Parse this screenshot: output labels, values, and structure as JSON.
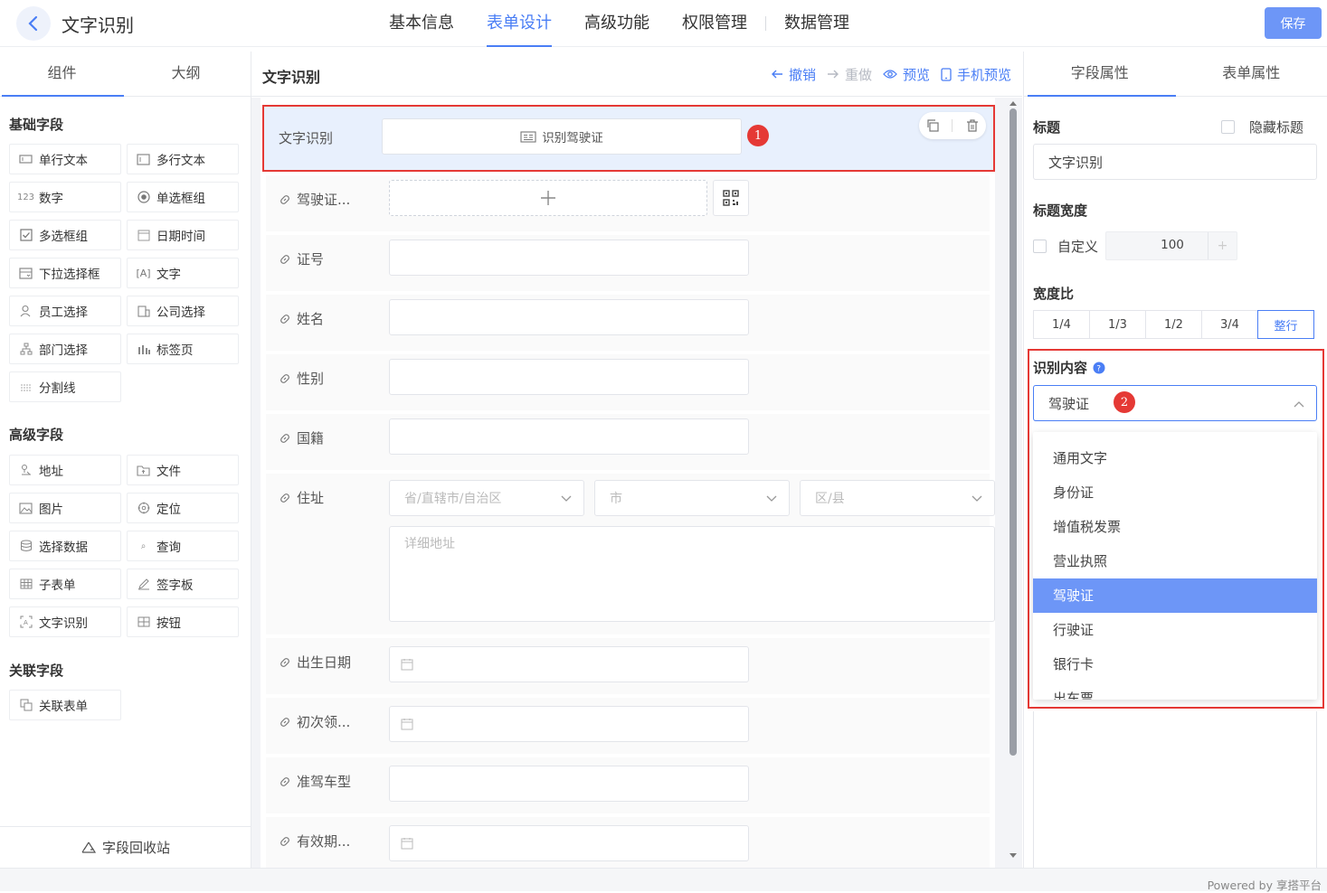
{
  "header": {
    "title": "文字识别",
    "nav": [
      "基本信息",
      "表单设计",
      "高级功能",
      "权限管理",
      "数据管理"
    ],
    "active_nav": 1,
    "save_label": "保存"
  },
  "left": {
    "tabs": [
      "组件",
      "大纲"
    ],
    "groups": [
      {
        "title": "基础字段",
        "items": [
          {
            "label": "单行文本",
            "icon": "single-line-icon"
          },
          {
            "label": "多行文本",
            "icon": "multi-line-icon"
          },
          {
            "label": "数字",
            "icon": "number-icon"
          },
          {
            "label": "单选框组",
            "icon": "radio-icon"
          },
          {
            "label": "多选框组",
            "icon": "checkbox-icon"
          },
          {
            "label": "日期时间",
            "icon": "calendar-icon"
          },
          {
            "label": "下拉选择框",
            "icon": "dropdown-icon"
          },
          {
            "label": "文字",
            "icon": "text-icon"
          },
          {
            "label": "员工选择",
            "icon": "user-icon"
          },
          {
            "label": "公司选择",
            "icon": "company-icon"
          },
          {
            "label": "部门选择",
            "icon": "org-icon"
          },
          {
            "label": "标签页",
            "icon": "tabs-icon"
          },
          {
            "label": "分割线",
            "icon": "divider-icon"
          }
        ]
      },
      {
        "title": "高级字段",
        "items": [
          {
            "label": "地址",
            "icon": "address-icon"
          },
          {
            "label": "文件",
            "icon": "file-icon"
          },
          {
            "label": "图片",
            "icon": "image-icon"
          },
          {
            "label": "定位",
            "icon": "location-icon"
          },
          {
            "label": "选择数据",
            "icon": "database-icon"
          },
          {
            "label": "查询",
            "icon": "query-icon"
          },
          {
            "label": "子表单",
            "icon": "subform-icon"
          },
          {
            "label": "签字板",
            "icon": "signature-icon"
          },
          {
            "label": "文字识别",
            "icon": "ocr-icon"
          },
          {
            "label": "按钮",
            "icon": "button-icon"
          }
        ]
      },
      {
        "title": "关联字段",
        "items": [
          {
            "label": "关联表单",
            "icon": "link-form-icon"
          }
        ]
      }
    ],
    "recycle_label": "字段回收站"
  },
  "center": {
    "title": "文字识别",
    "tools": {
      "undo": "撤销",
      "redo": "重做",
      "preview": "预览",
      "mobile_preview": "手机预览"
    },
    "selected_field": {
      "label": "文字识别",
      "button": "识别驾驶证",
      "badge": "1"
    },
    "fields": {
      "license": "驾驶证...",
      "number": "证号",
      "name": "姓名",
      "gender": "性别",
      "nationality": "国籍",
      "address": "住址",
      "birth": "出生日期",
      "first_issue": "初次领...",
      "vehicle_type": "准驾车型",
      "valid": "有效期..."
    },
    "address_placeholders": {
      "province": "省/直辖市/自治区",
      "city": "市",
      "district": "区/县",
      "detail": "详细地址"
    }
  },
  "right": {
    "tabs": [
      "字段属性",
      "表单属性"
    ],
    "title_label": "标题",
    "hide_title": "隐藏标题",
    "title_value": "文字识别",
    "width_label": "标题宽度",
    "custom_label": "自定义",
    "width_value": "100",
    "ratio_label": "宽度比",
    "ratios": [
      "1/4",
      "1/3",
      "1/2",
      "3/4",
      "整行"
    ],
    "recognize_label": "识别内容",
    "recognize_value": "驾驶证",
    "badge": "2",
    "options": [
      "通用文字",
      "身份证",
      "增值税发票",
      "营业执照",
      "驾驶证",
      "行驶证",
      "银行卡",
      "出车票"
    ]
  },
  "footer": {
    "powered": "Powered by 享搭平台"
  },
  "colors": {
    "accent": "#4a7ef5",
    "highlight": "#e53935",
    "selected_option": "#6d96f7"
  }
}
